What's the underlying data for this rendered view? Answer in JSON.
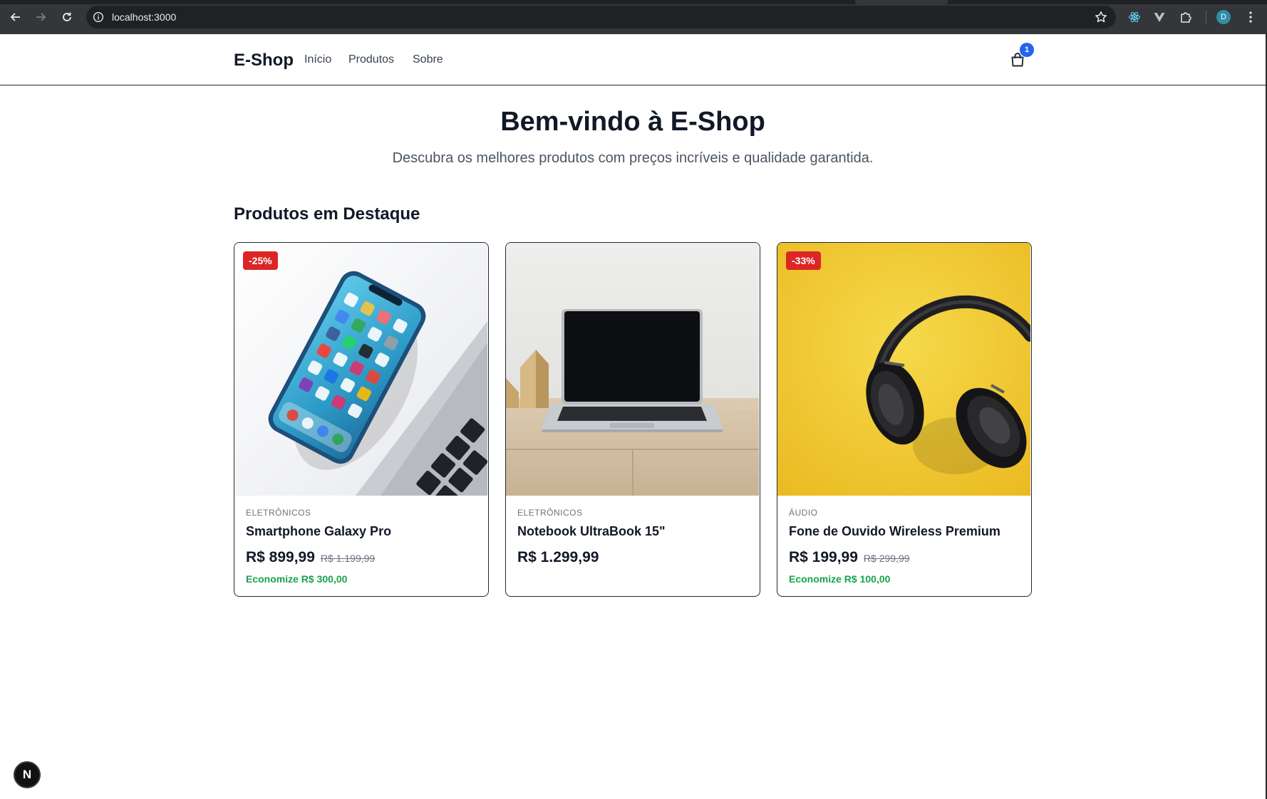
{
  "browser": {
    "url": "localhost:3000",
    "profile_initial": "D",
    "icons": [
      "back-icon",
      "forward-icon",
      "reload-icon",
      "site-info-icon",
      "bookmark-star-icon",
      "react-devtools-icon",
      "vue-devtools-icon",
      "extensions-icon",
      "menu-icon"
    ]
  },
  "header": {
    "logo": "E-Shop",
    "nav": [
      "Início",
      "Produtos",
      "Sobre"
    ],
    "cart_count": "1"
  },
  "hero": {
    "title": "Bem-vindo à E-Shop",
    "subtitle": "Descubra os melhores produtos com preços incríveis e qualidade garantida."
  },
  "featured": {
    "title": "Produtos em Destaque",
    "products": [
      {
        "badge": "-25%",
        "category": "ELETRÔNICOS",
        "name": "Smartphone Galaxy Pro",
        "price": "R$ 899,99",
        "old_price": "R$ 1.199,99",
        "savings": "Economize R$ 300,00",
        "image": "smartphone-photo"
      },
      {
        "badge": "",
        "category": "ELETRÔNICOS",
        "name": "Notebook UltraBook 15\"",
        "price": "R$ 1.299,99",
        "old_price": "",
        "savings": "",
        "image": "laptop-photo"
      },
      {
        "badge": "-33%",
        "category": "ÁUDIO",
        "name": "Fone de Ouvido Wireless Premium",
        "price": "R$ 199,99",
        "old_price": "R$ 299,99",
        "savings": "Economize R$ 100,00",
        "image": "headphones-photo"
      }
    ]
  },
  "dev_indicator": "N",
  "colors": {
    "discount_badge": "#dc2626",
    "savings_text": "#16a34a",
    "cart_badge": "#2563eb",
    "headphones_bg": "#f2cc2e"
  }
}
